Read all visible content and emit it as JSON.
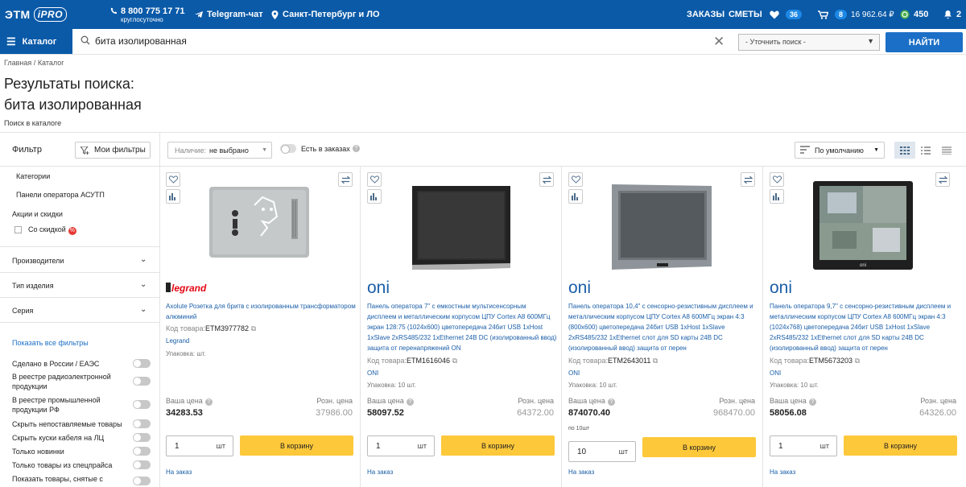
{
  "header": {
    "logo": "ЭТМ",
    "logo_sub": "iPRO",
    "phone": "8 800 775 17 71",
    "phone_sub": "круглосуточно",
    "telegram": "Telegram-чат",
    "city": "Санкт-Петербург и ЛО",
    "orders": "ЗАКАЗЫ",
    "estimates": "СМЕТЫ",
    "favorites_count": "36",
    "cart_count": "8",
    "cart_total": "16 962.64 ₽",
    "bonus": "450",
    "notifications": "2"
  },
  "search": {
    "catalog_label": "Каталог",
    "query": "бита изолированная",
    "refine_placeholder": "- Уточнить поиск -",
    "find_label": "НАЙТИ"
  },
  "breadcrumb": {
    "home": "Главная",
    "sep": "/",
    "current": "Каталог"
  },
  "page": {
    "title_line1": "Результаты поиска:",
    "title_line2": "бита изолированная",
    "in_catalog": "Поиск в каталоге"
  },
  "filter": {
    "title": "Фильтр",
    "my_filters": "Мои фильтры",
    "categories_label": "Категории",
    "category_item": "Панели оператора АСУТП",
    "promo_label": "Акции и скидки",
    "discount_label": "Со скидкой",
    "sections": [
      "Производители",
      "Тип изделия",
      "Серия"
    ],
    "show_all": "Показать все фильтры",
    "toggles": [
      "Сделано в России / ЕАЭС",
      "В реестре радиоэлектронной продукции",
      "В реестре промышленной продукции РФ",
      "Скрыть непоставляемые товары",
      "Скрыть куски кабеля на ЛЦ",
      "Только новинки",
      "Только товары из спецпрайса",
      "Показать товары, снятые с"
    ]
  },
  "toolbar": {
    "availability_label": "Наличие:",
    "availability_value": "не выбрано",
    "in_orders": "Есть в заказах",
    "sort": "По умолчанию"
  },
  "products": [
    {
      "brand": "legrand",
      "title": "Axolute Розетка для бритв с изолированным трансформатором алюминий",
      "code_label": "Код товара:",
      "code": "ETM3977782",
      "manufacturer": "Legrand",
      "pack": "Упаковка: шт.",
      "price_label": "Ваша цена",
      "price": "34283.53",
      "retail_label": "Розн. цена",
      "retail": "37986.00",
      "per_unit": "",
      "qty": "1",
      "unit": "шт",
      "buy": "В корзину",
      "status": "На заказ"
    },
    {
      "brand": "oni",
      "title": "Панель оператора 7\" с емкостным мультисенсорным дисплеем и металлическим корпусом ЦПУ Cortex A8 600МГц экран 128:75 (1024x600) цветопередача 24бит USB 1xHost 1xSlave 2xRS485/232 1xEthernet 24В DC (изолированный ввод) защита от перенапряжений ON",
      "code_label": "Код товара:",
      "code": "ETM1616046",
      "manufacturer": "ONI",
      "pack": "Упаковка: 10 шт.",
      "price_label": "Ваша цена",
      "price": "58097.52",
      "retail_label": "Розн. цена",
      "retail": "64372.00",
      "per_unit": "",
      "qty": "1",
      "unit": "шт",
      "buy": "В корзину",
      "status": "На заказ"
    },
    {
      "brand": "oni",
      "title": "Панель оператора 10,4\" с сенсорно-резистивным дисплеем и металлическим корпусом ЦПУ Cortex A8 600МГц экран 4:3 (800x600) цветопередача 24бит USB 1xHost 1xSlave 2xRS485/232 1xEthernet слот для SD карты 24В DC (изолированный ввод) защита от перен",
      "code_label": "Код товара:",
      "code": "ETM2643011",
      "manufacturer": "ONI",
      "pack": "Упаковка: 10 шт.",
      "price_label": "Ваша цена",
      "price": "874070.40",
      "retail_label": "Розн. цена",
      "retail": "968470.00",
      "per_unit": "по 10шт",
      "qty": "10",
      "unit": "шт",
      "buy": "В корзину",
      "status": "На заказ"
    },
    {
      "brand": "oni",
      "title": "Панель оператора 9,7\" с сенсорно-резистивным дисплеем и металлическим корпусом ЦПУ Cortex A8 600МГц экран 4:3 (1024x768) цветопередача 24бит USB 1xHost 1xSlave 2xRS485/232 1xEthernet слот для SD карты 24В DC (изолированный ввод) защита от перен",
      "code_label": "Код товара:",
      "code": "ETM5673203",
      "manufacturer": "ONI",
      "pack": "Упаковка: 10 шт.",
      "price_label": "Ваша цена",
      "price": "58056.08",
      "retail_label": "Розн. цена",
      "retail": "64326.00",
      "per_unit": "",
      "qty": "1",
      "unit": "шт",
      "buy": "В корзину",
      "status": "На заказ"
    }
  ],
  "colors": {
    "brand_blue": "#0a5aa8",
    "button_blue": "#1b6fc6",
    "buy_yellow": "#fdc83a",
    "link_blue": "#1b5fa8",
    "legrand_red": "#e30613"
  }
}
